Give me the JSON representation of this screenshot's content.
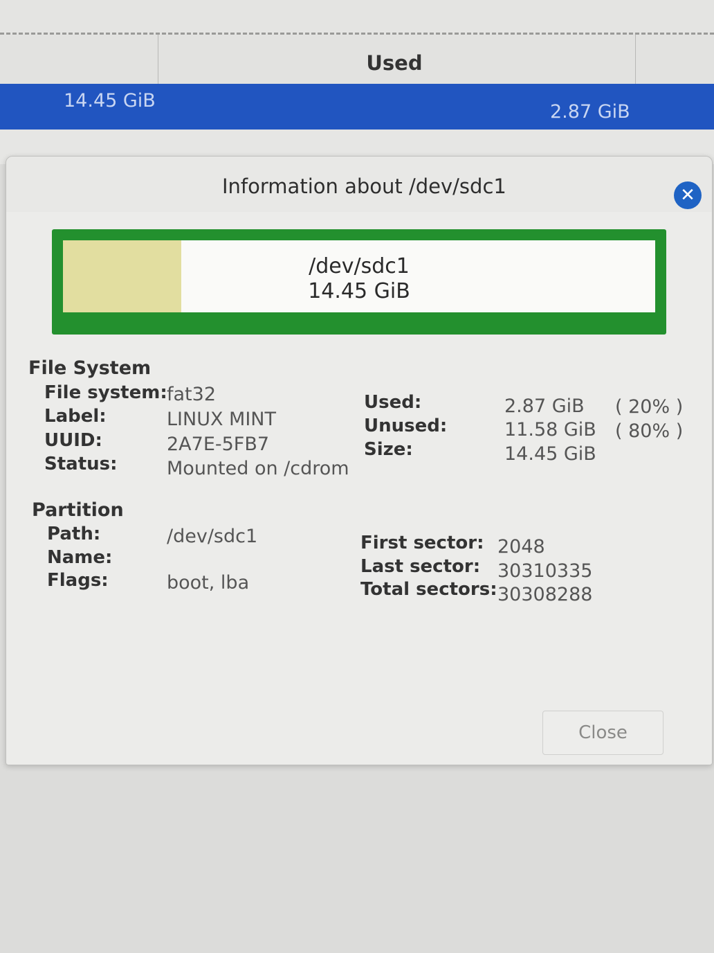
{
  "main_window": {
    "column_header_used": "Used",
    "selected_row": {
      "size": "14.45 GiB",
      "used": "2.87 GiB"
    },
    "accent_color": "#2155c0"
  },
  "dialog": {
    "title": "Information about /dev/sdc1",
    "close_icon": "close-circle-icon",
    "partition_graphic": {
      "path": "/dev/sdc1",
      "size": "14.45 GiB",
      "used_fraction": 0.2,
      "border_color": "#23902e",
      "used_color": "#e2dea0"
    },
    "file_system": {
      "heading": "File System",
      "labels": {
        "file_system": "File system:",
        "label": "Label:",
        "uuid": "UUID:",
        "status": "Status:",
        "used": "Used:",
        "unused": "Unused:",
        "size": "Size:"
      },
      "values": {
        "file_system": "fat32",
        "label": "LINUX MINT",
        "uuid": "2A7E-5FB7",
        "status": "Mounted on /cdrom",
        "used": "2.87 GiB",
        "used_pct": "( 20% )",
        "unused": "11.58 GiB",
        "unused_pct": "( 80% )",
        "size": "14.45 GiB"
      }
    },
    "partition": {
      "heading": "Partition",
      "labels": {
        "path": "Path:",
        "name": "Name:",
        "flags": "Flags:",
        "first_sector": "First sector:",
        "last_sector": "Last sector:",
        "total_sectors": "Total sectors:"
      },
      "values": {
        "path": "/dev/sdc1",
        "name": "",
        "flags": "boot, lba",
        "first_sector": "2048",
        "last_sector": "30310335",
        "total_sectors": "30308288"
      }
    },
    "close_button": "Close"
  }
}
